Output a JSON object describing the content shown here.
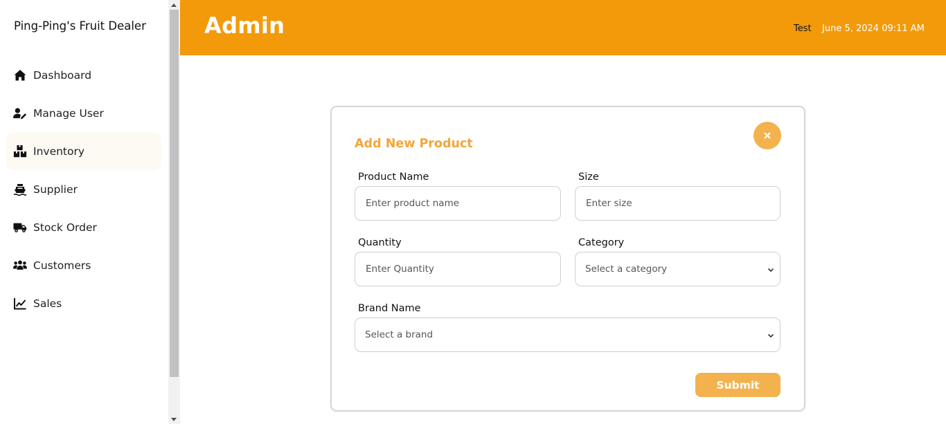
{
  "sidebar": {
    "brand": "Ping-Ping's Fruit Dealer",
    "items": [
      {
        "label": "Dashboard",
        "icon": "home-icon"
      },
      {
        "label": "Manage User",
        "icon": "user-edit-icon"
      },
      {
        "label": "Inventory",
        "icon": "boxes-icon",
        "active": true
      },
      {
        "label": "Supplier",
        "icon": "ship-icon"
      },
      {
        "label": "Stock Order",
        "icon": "truck-icon"
      },
      {
        "label": "Customers",
        "icon": "users-icon"
      },
      {
        "label": "Sales",
        "icon": "chart-line-icon"
      }
    ]
  },
  "header": {
    "title": "Admin",
    "user": "Test",
    "datetime": "June 5, 2024 09:11 AM"
  },
  "modal": {
    "title": "Add New Product",
    "close_label": "×",
    "fields": {
      "product_name": {
        "label": "Product Name",
        "placeholder": "Enter product name"
      },
      "size": {
        "label": "Size",
        "placeholder": "Enter size"
      },
      "quantity": {
        "label": "Quantity",
        "placeholder": "Enter Quantity"
      },
      "category": {
        "label": "Category",
        "selected": "Select a category"
      },
      "brand": {
        "label": "Brand Name",
        "selected": "Select a brand"
      }
    },
    "submit_label": "Submit"
  },
  "colors": {
    "header_bg": "#f39a0a",
    "accent": "#f3b24e",
    "title_accent": "#f3a63a"
  }
}
